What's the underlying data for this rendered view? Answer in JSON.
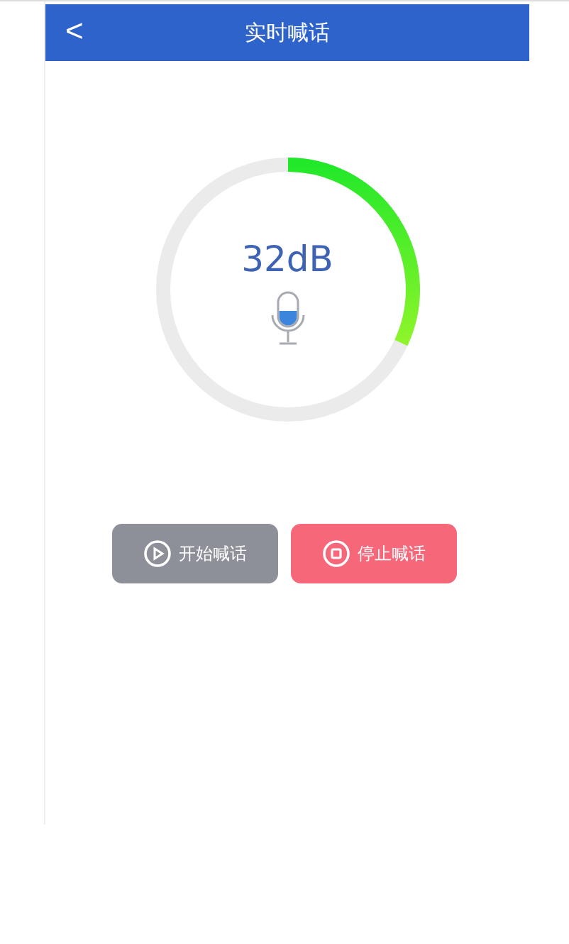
{
  "header": {
    "back": "<",
    "title": "实时喊话"
  },
  "meter": {
    "reading": "32dB"
  },
  "buttons": [
    {
      "kind": "start",
      "label": "开始喊话"
    },
    {
      "kind": "stop",
      "label": "停止喊话"
    }
  ]
}
